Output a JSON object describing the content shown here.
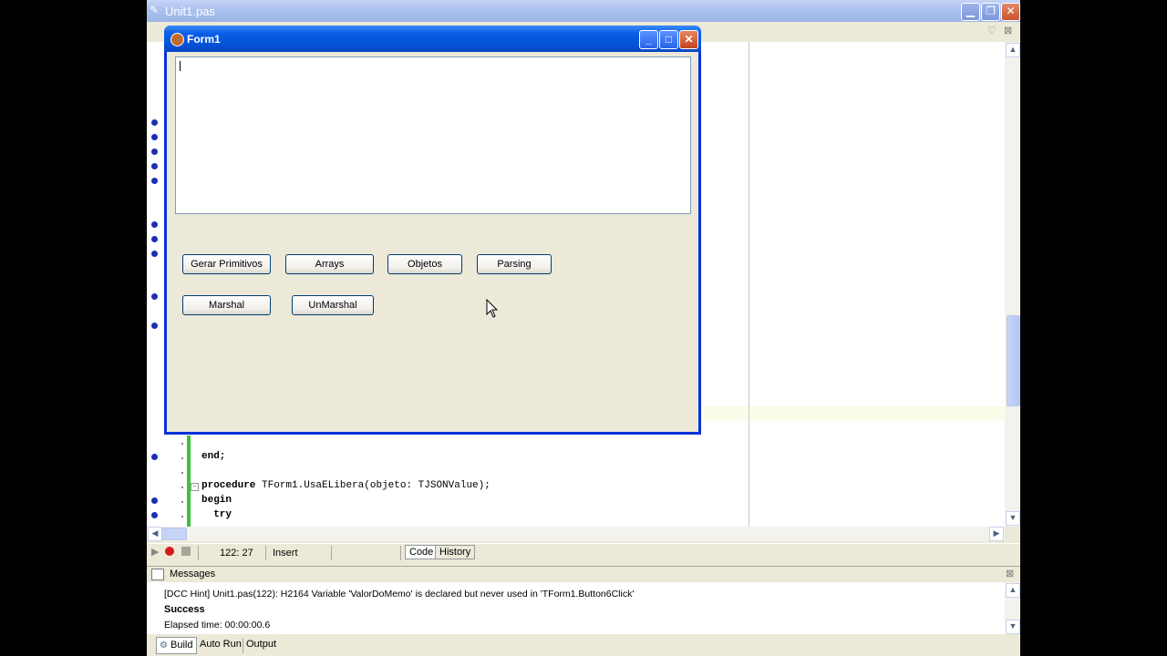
{
  "ide": {
    "title": "Unit1.pas",
    "controls": {
      "minimize": "▁",
      "restore": "❐",
      "close": "✕"
    }
  },
  "code_lines": [
    {
      "text": "end;",
      "bold": true
    },
    {
      "text": "procedure TForm1.UsaELibera(objeto: TJSONValue);",
      "bold_prefix": "procedure"
    },
    {
      "text": "begin",
      "bold": true
    },
    {
      "text": "  try",
      "bold": true
    }
  ],
  "status": {
    "position": "122:  27",
    "mode": "Insert",
    "tabs": [
      "Code",
      "History"
    ]
  },
  "messages": {
    "title": "Messages",
    "lines": [
      {
        "text": "[DCC Hint] Unit1.pas(122): H2164 Variable 'ValorDoMemo' is declared but never used in 'TForm1.Button6Click'",
        "bold": false
      },
      {
        "text": "Success",
        "bold": true
      },
      {
        "text": "Elapsed time: 00:00:00.6",
        "bold": false
      }
    ]
  },
  "bottom_tabs": [
    "Build",
    "Auto Run",
    "Output"
  ],
  "form1": {
    "title": "Form1",
    "memo_value": "",
    "buttons_row1": [
      "Gerar Primitivos",
      "Arrays",
      "Objetos",
      "Parsing"
    ],
    "buttons_row2": [
      "Marshal",
      "UnMarshal"
    ]
  }
}
